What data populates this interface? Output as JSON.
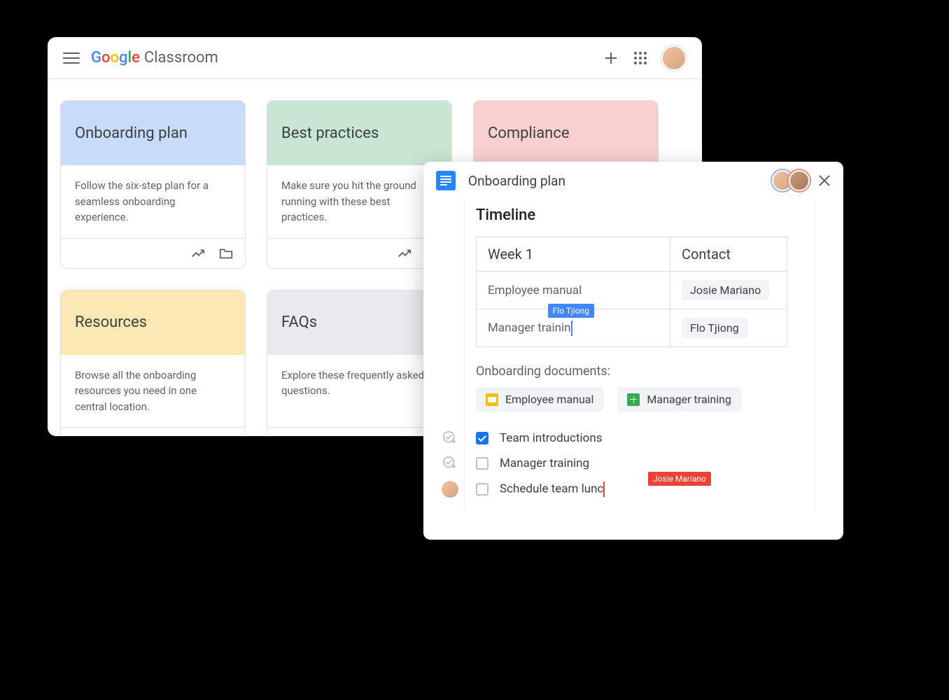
{
  "classroom": {
    "app_name": "Classroom",
    "cards": [
      {
        "title": "Onboarding plan",
        "desc": "Follow the six-step plan for a seamless onboarding experience.",
        "color": "c-blue"
      },
      {
        "title": "Best practices",
        "desc": "Make sure you hit the ground running with these best practices.",
        "color": "c-green"
      },
      {
        "title": "Compliance",
        "desc": "",
        "color": "c-red"
      },
      {
        "title": "Resources",
        "desc": "Browse all the onboarding resources you need in one central location.",
        "color": "c-yellow"
      },
      {
        "title": "FAQs",
        "desc": "Explore these frequently asked questions.",
        "color": "c-gray"
      }
    ]
  },
  "docs": {
    "title": "Onboarding plan",
    "timeline_heading": "Timeline",
    "table": {
      "week_header": "Week 1",
      "contact_header": "Contact",
      "rows": [
        {
          "item": "Employee manual",
          "contact": "Josie Mariano"
        },
        {
          "item": "Manager trainin",
          "contact": "Flo Tjiong"
        }
      ]
    },
    "cursors": {
      "blue": "Flo Tjiong",
      "red": "Josie Mariano"
    },
    "docs_subheading": "Onboarding documents:",
    "doc_chips": [
      {
        "label": "Employee manual",
        "icon": "slides"
      },
      {
        "label": "Manager training",
        "icon": "sheets"
      }
    ],
    "checklist": [
      {
        "label": "Team introductions",
        "checked": true,
        "icon": "add-check"
      },
      {
        "label": "Manager training",
        "checked": false,
        "icon": "add-check"
      },
      {
        "label": "Schedule team lunc",
        "checked": false,
        "icon": "avatar",
        "cursor": "red"
      }
    ]
  }
}
